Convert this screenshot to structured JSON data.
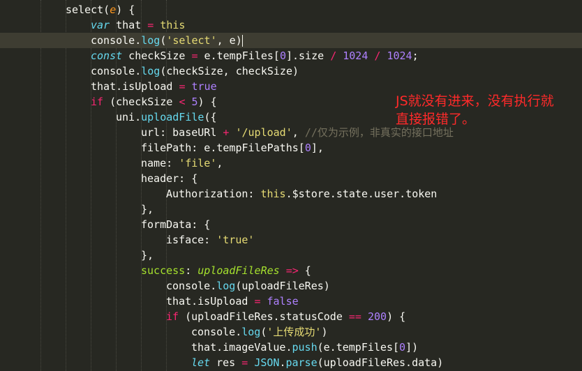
{
  "code_lines": [
    [
      [
        "w",
        "select("
      ],
      [
        "p",
        "e"
      ],
      [
        "w",
        ") {"
      ]
    ],
    [
      [
        "fi",
        "var"
      ],
      [
        "w",
        " that "
      ],
      [
        "k",
        "="
      ],
      [
        "w",
        " "
      ],
      [
        "y",
        "this"
      ]
    ],
    [
      [
        "w",
        "console."
      ],
      [
        "f",
        "log"
      ],
      [
        "w",
        "("
      ],
      [
        "s",
        "'select'"
      ],
      [
        "w",
        ", e)"
      ]
    ],
    [
      [
        "fi",
        "const"
      ],
      [
        "w",
        " checkSize "
      ],
      [
        "k",
        "="
      ],
      [
        "w",
        " e.tempFiles["
      ],
      [
        "n",
        "0"
      ],
      [
        "w",
        "].size "
      ],
      [
        "k",
        "/"
      ],
      [
        "w",
        " "
      ],
      [
        "n",
        "1024"
      ],
      [
        "w",
        " "
      ],
      [
        "k",
        "/"
      ],
      [
        "w",
        " "
      ],
      [
        "n",
        "1024"
      ],
      [
        "w",
        ";"
      ]
    ],
    [
      [
        "w",
        "console."
      ],
      [
        "f",
        "log"
      ],
      [
        "w",
        "(checkSize, checkSize)"
      ]
    ],
    [
      [
        "w",
        "that.isUpload "
      ],
      [
        "k",
        "="
      ],
      [
        "w",
        " "
      ],
      [
        "n",
        "true"
      ]
    ],
    [
      [
        "k",
        "if"
      ],
      [
        "w",
        " (checkSize "
      ],
      [
        "k",
        "<"
      ],
      [
        "w",
        " "
      ],
      [
        "n",
        "5"
      ],
      [
        "w",
        ") {"
      ]
    ],
    [
      [
        "w",
        "uni."
      ],
      [
        "f",
        "uploadFile"
      ],
      [
        "w",
        "({"
      ]
    ],
    [
      [
        "w",
        "url: baseURl "
      ],
      [
        "k",
        "+"
      ],
      [
        "w",
        " "
      ],
      [
        "s",
        "'/upload'"
      ],
      [
        "w",
        ", "
      ],
      [
        "c",
        "//仅为示例，非真实的接口地址"
      ]
    ],
    [
      [
        "w",
        "filePath: e.tempFilePaths["
      ],
      [
        "n",
        "0"
      ],
      [
        "w",
        "],"
      ]
    ],
    [
      [
        "w",
        "name: "
      ],
      [
        "s",
        "'file'"
      ],
      [
        "w",
        ","
      ]
    ],
    [
      [
        "w",
        "header: {"
      ]
    ],
    [
      [
        "w",
        "Authorization: "
      ],
      [
        "y",
        "this"
      ],
      [
        "w",
        ".$store.state.user.token"
      ]
    ],
    [
      [
        "w",
        "},"
      ]
    ],
    [
      [
        "w",
        "formData: {"
      ]
    ],
    [
      [
        "w",
        "isface: "
      ],
      [
        "s",
        "'true'"
      ]
    ],
    [
      [
        "w",
        "},"
      ]
    ],
    [
      [
        "g",
        "success"
      ],
      [
        "w",
        ": "
      ],
      [
        "gi",
        "uploadFileRes"
      ],
      [
        "w",
        " "
      ],
      [
        "k",
        "=>"
      ],
      [
        "w",
        " {"
      ]
    ],
    [
      [
        "w",
        "console."
      ],
      [
        "f",
        "log"
      ],
      [
        "w",
        "(uploadFileRes)"
      ]
    ],
    [
      [
        "w",
        "that.isUpload "
      ],
      [
        "k",
        "="
      ],
      [
        "w",
        " "
      ],
      [
        "n",
        "false"
      ]
    ],
    [
      [
        "k",
        "if"
      ],
      [
        "w",
        " (uploadFileRes.statusCode "
      ],
      [
        "k",
        "=="
      ],
      [
        "w",
        " "
      ],
      [
        "n",
        "200"
      ],
      [
        "w",
        ") {"
      ]
    ],
    [
      [
        "w",
        "console."
      ],
      [
        "f",
        "log"
      ],
      [
        "w",
        "("
      ],
      [
        "s",
        "'上传成功'"
      ],
      [
        "w",
        ")"
      ]
    ],
    [
      [
        "w",
        "that.imageValue."
      ],
      [
        "f",
        "push"
      ],
      [
        "w",
        "(e.tempFiles["
      ],
      [
        "n",
        "0"
      ],
      [
        "w",
        "])"
      ]
    ],
    [
      [
        "fi",
        "let"
      ],
      [
        "w",
        " res "
      ],
      [
        "k",
        "="
      ],
      [
        "w",
        " "
      ],
      [
        "f",
        "JSON"
      ],
      [
        "w",
        "."
      ],
      [
        "f",
        "parse"
      ],
      [
        "w",
        "(uploadFileRes.data)"
      ]
    ]
  ],
  "annotation": "JS就没有进来，没有执行就\n直接报错了。"
}
